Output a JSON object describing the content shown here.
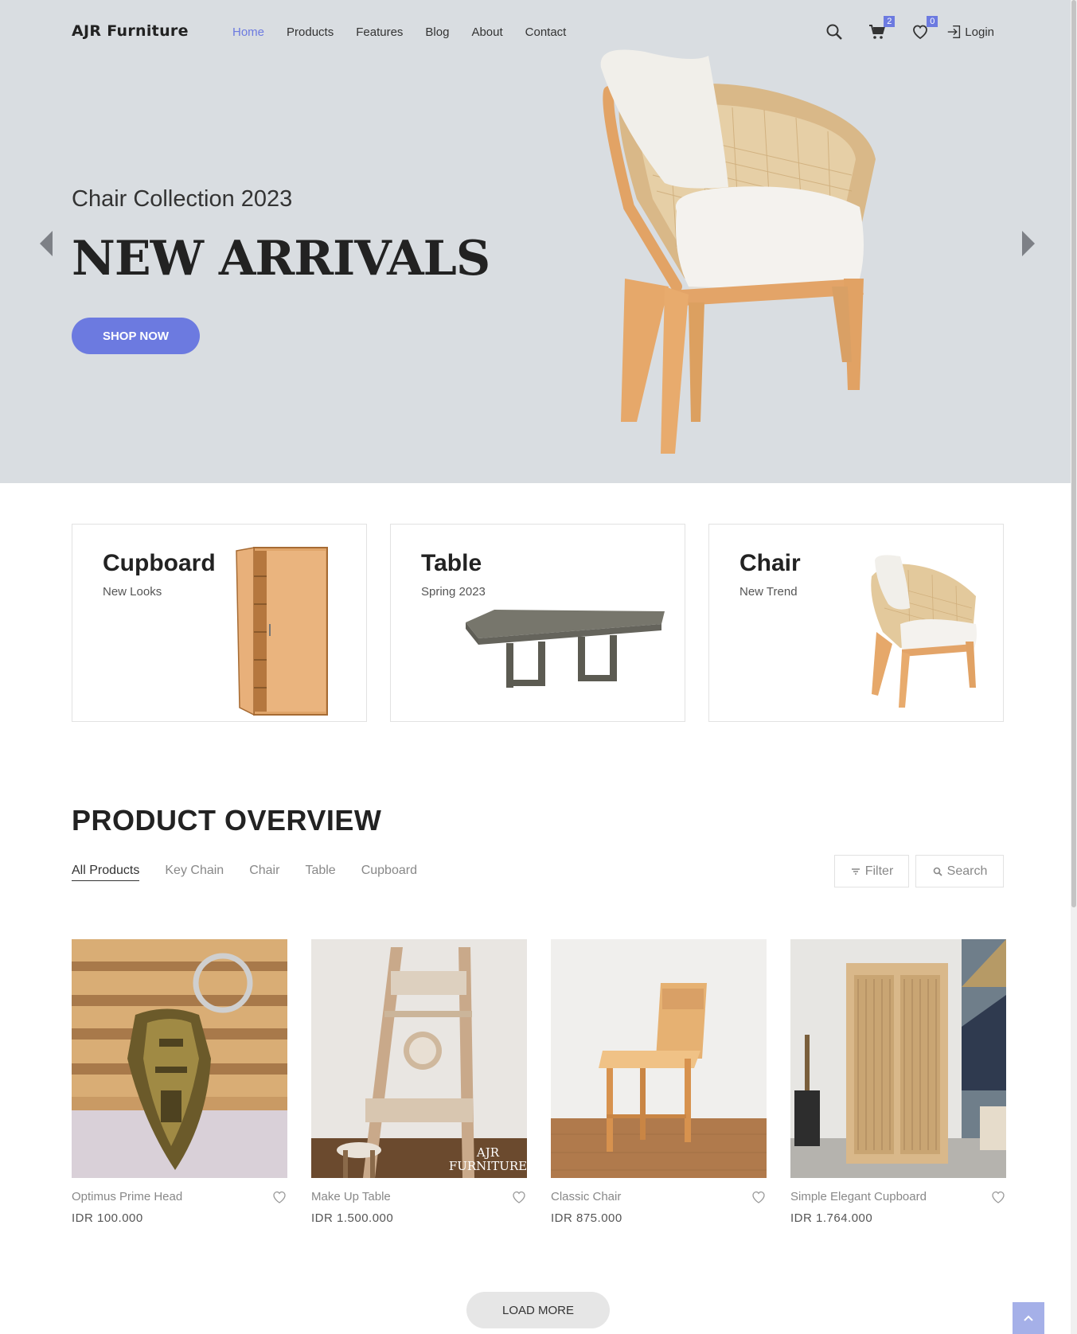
{
  "header": {
    "logo": "AJR Furniture",
    "nav": [
      "Home",
      "Products",
      "Features",
      "Blog",
      "About",
      "Contact"
    ],
    "active_nav": "Home",
    "cart_count": "2",
    "wishlist_count": "0",
    "login_label": "Login",
    "icons": [
      "search-icon",
      "cart-icon",
      "heart-icon",
      "login-icon"
    ]
  },
  "hero": {
    "subtitle": "Chair Collection 2023",
    "title": "NEW ARRIVALS",
    "button": "SHOP NOW",
    "accent": "#6c7ae0",
    "background": "#d9dde1"
  },
  "categories": [
    {
      "title": "Cupboard",
      "subtitle": "New Looks"
    },
    {
      "title": "Table",
      "subtitle": "Spring 2023"
    },
    {
      "title": "Chair",
      "subtitle": "New Trend"
    }
  ],
  "overview": {
    "title": "PRODUCT OVERVIEW",
    "tabs": [
      "All Products",
      "Key Chain",
      "Chair",
      "Table",
      "Cupboard"
    ],
    "active_tab": "All Products",
    "filter_label": "Filter",
    "search_label": "Search",
    "products": [
      {
        "name": "Optimus Prime Head",
        "price": "IDR 100.000"
      },
      {
        "name": "Make Up Table",
        "price": "IDR 1.500.000",
        "watermark_line1": "AJR",
        "watermark_line2": "FURNITURE"
      },
      {
        "name": "Classic Chair",
        "price": "IDR 875.000"
      },
      {
        "name": "Simple Elegant Cupboard",
        "price": "IDR 1.764.000"
      }
    ],
    "load_more": "LOAD MORE"
  }
}
